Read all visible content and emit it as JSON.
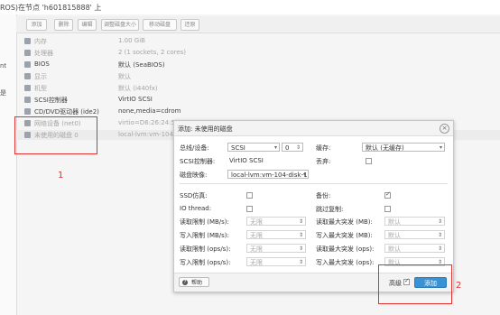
{
  "header": {
    "breadcrumb": "ROS)在节点 'h601815888' 上"
  },
  "left_pane": [
    "nt",
    "是"
  ],
  "toolbar": {
    "buttons": [
      "添加",
      "删除",
      "编辑",
      "调整磁盘大小",
      "移动磁盘",
      "还原"
    ]
  },
  "hardware_rows": [
    {
      "icon": "memory-icon",
      "key": "内存",
      "value": "1.00 GiB",
      "style": "dim"
    },
    {
      "icon": "cpu-icon",
      "key": "处理器",
      "value": "2 (1 sockets, 2 cores)",
      "style": "dim"
    },
    {
      "icon": "bios-icon",
      "key": "BIOS",
      "value": "默认 (SeaBIOS)",
      "style": "normal"
    },
    {
      "icon": "display-icon",
      "key": "显示",
      "value": "默认",
      "style": "dim"
    },
    {
      "icon": "machine-icon",
      "key": "机型",
      "value": "默认 (i440fx)",
      "style": "dim"
    },
    {
      "icon": "scsi-icon",
      "key": "SCSI控制器",
      "value": "VirtIO SCSI",
      "style": "normal"
    },
    {
      "icon": "cdrom-icon",
      "key": "CD/DVD驱动器 (ide2)",
      "value": "none,media=cdrom",
      "style": "normal"
    },
    {
      "icon": "network-icon",
      "key": "网络设备 (net0)",
      "value": "virtio=D6:26:24:5C:8",
      "style": "dim"
    },
    {
      "icon": "disk-icon",
      "key": "未使用的磁盘 0",
      "value": "local-lvm:vm-104-dis",
      "style": "selected"
    }
  ],
  "annotations": {
    "label_1": "1",
    "label_2": "2"
  },
  "dialog": {
    "title": "添加: 未使用的磁盘",
    "bus_label": "总线/设备:",
    "bus_value": "SCSI",
    "device_index": "0",
    "cache_label": "缓存:",
    "cache_value": "默认 (无缓存)",
    "scsi_ctrl_label": "SCSI控制器:",
    "scsi_ctrl_value": "VirtIO SCSI",
    "discard_label": "丢弃:",
    "disk_image_label": "磁盘映像:",
    "disk_image_value": "local-lvm:vm-104-disk-1",
    "ssd_label": "SSD仿真:",
    "backup_label": "备份:",
    "iothread_label": "IO thread:",
    "skip_repl_label": "跳过复制:",
    "read_mbs_label": "读取限制 (MB/s):",
    "write_mbs_label": "写入限制 (MB/s):",
    "read_ops_label": "读取限制 (ops/s):",
    "write_ops_label": "写入限制 (ops/s):",
    "read_burst_mb_label": "读取最大突发 (MB):",
    "write_burst_mb_label": "写入最大突发 (MB):",
    "read_burst_ops_label": "读取最大突发 (ops):",
    "write_burst_ops_label": "写入最大突发 (ops):",
    "unlimited": "无限",
    "default": "默认",
    "help_label": "帮助",
    "advanced_label": "高级",
    "add_label": "添加"
  }
}
